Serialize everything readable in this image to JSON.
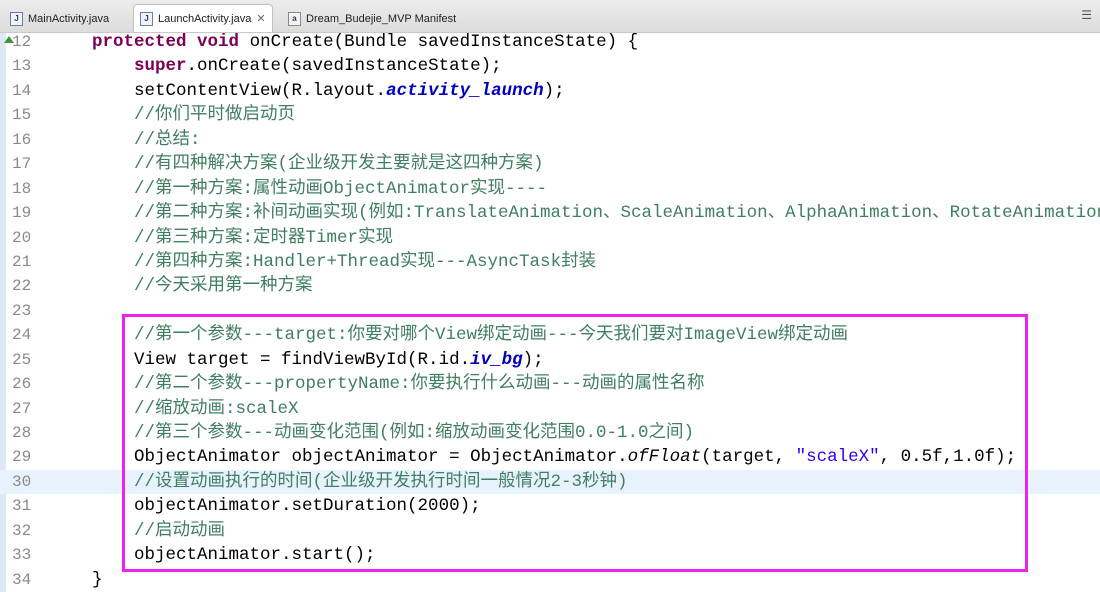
{
  "tabs": [
    {
      "label": "MainActivity.java",
      "icon": "java-file-icon",
      "active": false
    },
    {
      "label": "LaunchActivity.java",
      "icon": "java-file-icon",
      "active": true
    },
    {
      "label": "Dream_Budejie_MVP Manifest",
      "icon": "manifest-file-icon",
      "active": false
    }
  ],
  "tab_menu": "☰",
  "lines": [
    {
      "n": "12",
      "seg": [
        [
          "",
          "    "
        ],
        [
          "kw",
          "protected"
        ],
        [
          "",
          " "
        ],
        [
          "kw",
          "void"
        ],
        [
          "",
          " onCreate(Bundle savedInstanceState) {"
        ]
      ]
    },
    {
      "n": "13",
      "seg": [
        [
          "",
          "        "
        ],
        [
          "kw",
          "super"
        ],
        [
          "",
          ".onCreate(savedInstanceState);"
        ]
      ]
    },
    {
      "n": "14",
      "seg": [
        [
          "",
          "        setContentView(R.layout."
        ],
        [
          "fld",
          "activity_launch"
        ],
        [
          "",
          ");"
        ]
      ]
    },
    {
      "n": "15",
      "seg": [
        [
          "",
          "        "
        ],
        [
          "cm",
          "//你们平时做启动页"
        ]
      ]
    },
    {
      "n": "16",
      "seg": [
        [
          "",
          "        "
        ],
        [
          "cm",
          "//总结:"
        ]
      ]
    },
    {
      "n": "17",
      "seg": [
        [
          "",
          "        "
        ],
        [
          "cm",
          "//有四种解决方案(企业级开发主要就是这四种方案)"
        ]
      ]
    },
    {
      "n": "18",
      "seg": [
        [
          "",
          "        "
        ],
        [
          "cm",
          "//第一种方案:属性动画ObjectAnimator实现----"
        ]
      ]
    },
    {
      "n": "19",
      "seg": [
        [
          "",
          "        "
        ],
        [
          "cm",
          "//第二种方案:补间动画实现(例如:TranslateAnimation、ScaleAnimation、AlphaAnimation、RotateAnimation)"
        ]
      ]
    },
    {
      "n": "20",
      "seg": [
        [
          "",
          "        "
        ],
        [
          "cm",
          "//第三种方案:定时器Timer实现"
        ]
      ]
    },
    {
      "n": "21",
      "seg": [
        [
          "",
          "        "
        ],
        [
          "cm",
          "//第四种方案:Handler+Thread实现---AsyncTask封装"
        ]
      ]
    },
    {
      "n": "22",
      "seg": [
        [
          "",
          "        "
        ],
        [
          "cm",
          "//今天采用第一种方案"
        ]
      ]
    },
    {
      "n": "23",
      "seg": [
        [
          "",
          ""
        ]
      ]
    },
    {
      "n": "24",
      "seg": [
        [
          "",
          "        "
        ],
        [
          "cm",
          "//第一个参数---target:你要对哪个View绑定动画---今天我们要对ImageView绑定动画"
        ]
      ]
    },
    {
      "n": "25",
      "seg": [
        [
          "",
          "        View target = findViewById(R.id."
        ],
        [
          "fld",
          "iv_bg"
        ],
        [
          "",
          ");"
        ]
      ]
    },
    {
      "n": "26",
      "seg": [
        [
          "",
          "        "
        ],
        [
          "cm",
          "//第二个参数---propertyName:你要执行什么动画---动画的属性名称"
        ]
      ]
    },
    {
      "n": "27",
      "seg": [
        [
          "",
          "        "
        ],
        [
          "cm",
          "//缩放动画:scaleX"
        ]
      ]
    },
    {
      "n": "28",
      "seg": [
        [
          "",
          "        "
        ],
        [
          "cm",
          "//第三个参数---动画变化范围(例如:缩放动画变化范围0.0-1.0之间)"
        ]
      ]
    },
    {
      "n": "29",
      "seg": [
        [
          "",
          "        ObjectAnimator objectAnimator = ObjectAnimator."
        ],
        [
          "it",
          "ofFloat"
        ],
        [
          "",
          "(target, "
        ],
        [
          "st",
          "\"scaleX\""
        ],
        [
          "",
          ", 0.5f,1.0f);"
        ]
      ]
    },
    {
      "n": "30",
      "hl": true,
      "seg": [
        [
          "",
          "        "
        ],
        [
          "cm",
          "//设置动画执行的时间(企业级开发执行时间一般情况2-3秒钟)"
        ]
      ]
    },
    {
      "n": "31",
      "seg": [
        [
          "",
          "        objectAnimator.setDuration(2000);"
        ]
      ]
    },
    {
      "n": "32",
      "seg": [
        [
          "",
          "        "
        ],
        [
          "cm",
          "//启动动画"
        ]
      ]
    },
    {
      "n": "33",
      "seg": [
        [
          "",
          "        objectAnimator.start();"
        ]
      ]
    },
    {
      "n": "34",
      "seg": [
        [
          "",
          "    }"
        ]
      ]
    }
  ],
  "colors": {
    "highlight_box": "#ee22ee",
    "comment": "#3f7f5f",
    "keyword": "#7f0055"
  }
}
